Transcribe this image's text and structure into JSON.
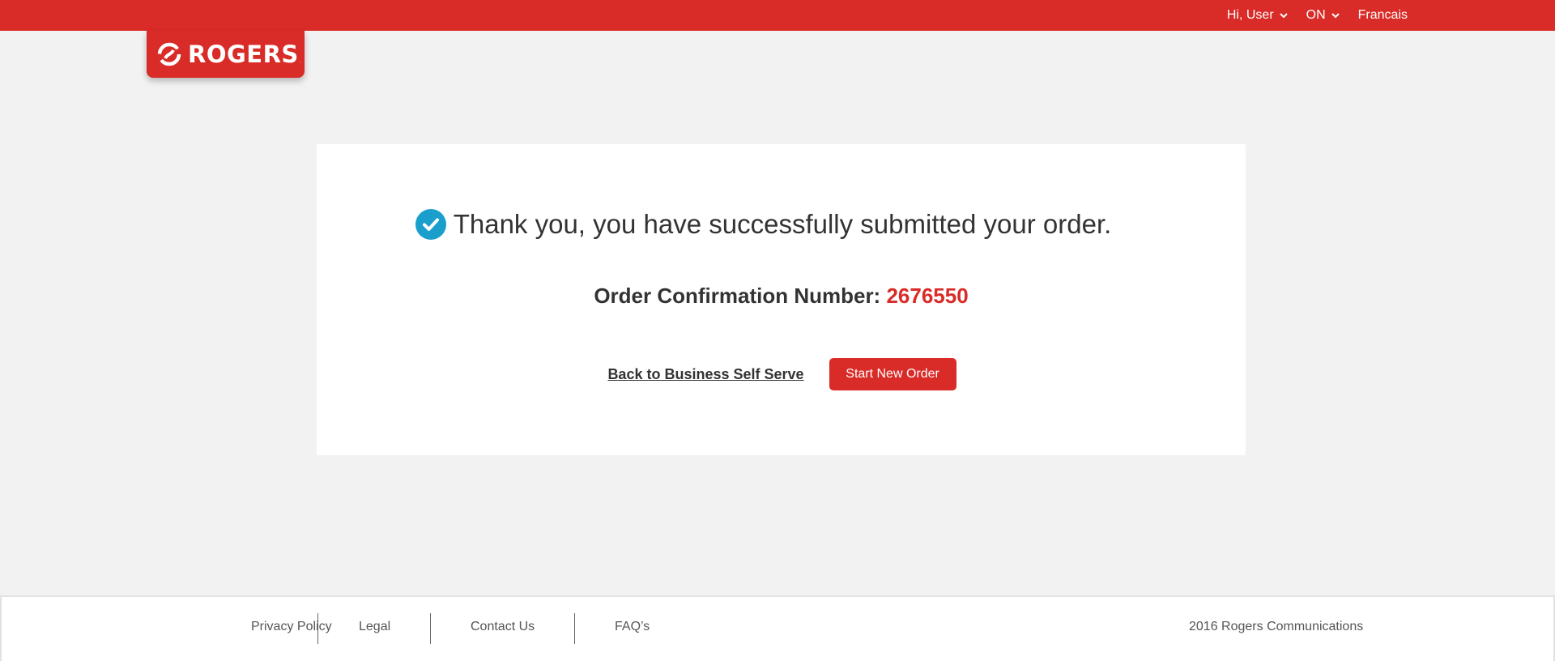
{
  "header": {
    "user_label": "Hi, User",
    "province_label": "ON",
    "language_label": "Francais",
    "icons": [
      "chevron-down-icon"
    ]
  },
  "logo": {
    "text": "ROGERS",
    "registered": "."
  },
  "confirmation": {
    "message": "Thank you, you have successfully submitted your order.",
    "number_label": "Order Confirmation Number: ",
    "number": "2676550",
    "back_link": "Back to Business Self Serve",
    "start_button": "Start New Order"
  },
  "footer": {
    "links": [
      "Privacy Policy",
      "Legal",
      "Contact Us",
      "FAQ’s"
    ],
    "copyright": "2016 Rogers Communications"
  },
  "colors": {
    "brand_red": "#d92b27",
    "check_blue": "#1a9fcc",
    "background": "#f3f2f2"
  }
}
